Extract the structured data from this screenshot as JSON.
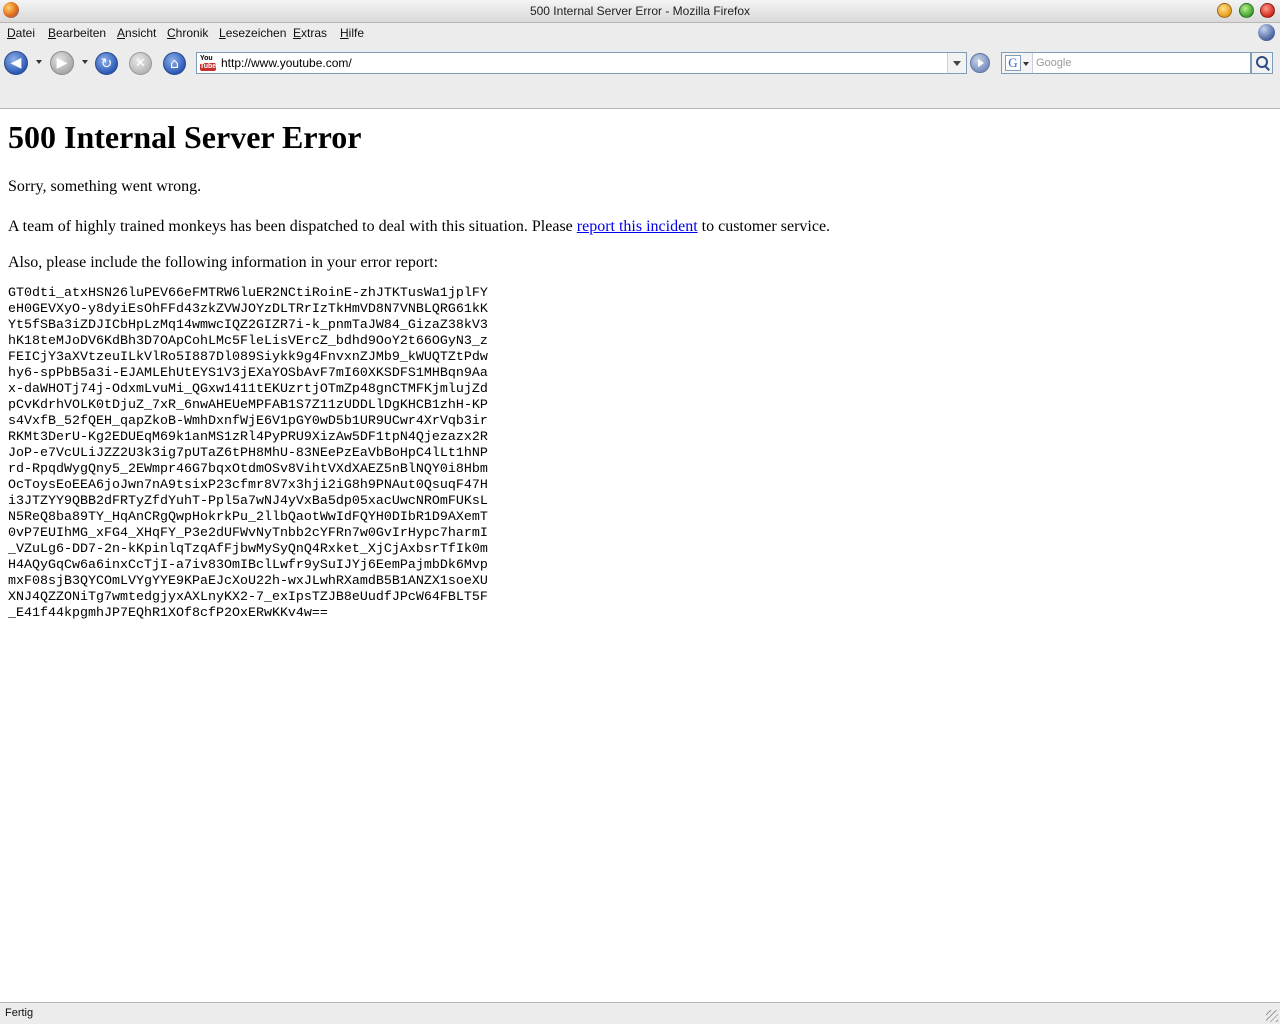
{
  "window": {
    "title": "500 Internal Server Error - Mozilla Firefox"
  },
  "menu": [
    {
      "access": "D",
      "rest": "atei"
    },
    {
      "access": "B",
      "rest": "earbeiten"
    },
    {
      "access": "A",
      "rest": "nsicht"
    },
    {
      "access": "C",
      "rest": "hronik"
    },
    {
      "access": "L",
      "rest": "esezeichen"
    },
    {
      "access": "E",
      "rest": "xtras"
    },
    {
      "access": "H",
      "rest": "ilfe"
    }
  ],
  "navigation": {
    "url": "http://www.youtube.com/",
    "favicon_top": "You",
    "favicon_bottom": "Tube"
  },
  "search": {
    "placeholder": "Google",
    "engine_glyph": "G"
  },
  "page": {
    "heading": "500 Internal Server Error",
    "sorry": "Sorry, something went wrong.",
    "monkeys_before": "A team of highly trained monkeys has been dispatched to deal with this situation. Please ",
    "monkeys_link": "report this incident",
    "monkeys_after": " to customer service.",
    "include": "Also, please include the following information in your error report:",
    "error_code": "GT0dti_atxHSN26luPEV66eFMTRW6luER2NCtiRoinE-zhJTKTusWa1jplFY\neH0GEVXyO-y8dyiEsOhFFd43zkZVWJOYzDLTRrIzTkHmVD8N7VNBLQRG61kK\nYt5fSBa3iZDJICbHpLzMq14wmwcIQZ2GIZR7i-k_pnmTaJW84_GizaZ38kV3\nhK18teMJoDV6KdBh3D7OApCohLMc5FleLisVErcZ_bdhd9OoY2t66OGyN3_z\nFEICjY3aXVtzeuILkVlRo5I887Dl089Siykk9g4FnvxnZJMb9_kWUQTZtPdw\nhy6-spPbB5a3i-EJAMLEhUtEYS1V3jEXaYOSbAvF7mI60XKSDFS1MHBqn9Aa\nx-daWHOTj74j-OdxmLvuMi_QGxw1411tEKUzrtjOTmZp48gnCTMFKjmlujZd\npCvKdrhVOLK0tDjuZ_7xR_6nwAHEUeMPFAB1S7Z11zUDDLlDgKHCB1zhH-KP\ns4VxfB_52fQEH_qapZkoB-WmhDxnfWjE6V1pGY0wD5b1UR9UCwr4XrVqb3ir\nRKMt3DerU-Kg2EDUEqM69k1anMS1zRl4PyPRU9XizAw5DF1tpN4Qjezazx2R\nJoP-e7VcULiJZZ2U3k3ig7pUTaZ6tPH8MhU-83NEePzEaVbBoHpC4lLt1hNP\nrd-RpqdWygQny5_2EWmpr46G7bqxOtdmOSv8VihtVXdXAEZ5nBlNQY0i8Hbm\nOcToysEoEEA6joJwn7nA9tsixP23cfmr8V7x3hji2iG8h9PNAut0QsuqF47H\ni3JTZYY9QBB2dFRTyZfdYuhT-Ppl5a7wNJ4yVxBa5dp05xacUwcNROmFUKsL\nN5ReQ8ba89TY_HqAnCRgQwpHokrkPu_2llbQaotWwIdFQYH0DIbR1D9AXemT\n0vP7EUIhMG_xFG4_XHqFY_P3e2dUFWvNyTnbb2cYFRn7w0GvIrHypc7harmI\n_VZuLg6-DD7-2n-kKpinlqTzqAfFjbwMySyQnQ4Rxket_XjCjAxbsrTfIk0m\nH4AQyGqCw6a6inxCcTjI-a7iv83OmIBclLwfr9ySuIJYj6EemPajmbDk6Mvp\nmxF08sjB3QYCOmLVYgYYE9KPaEJcXoU22h-wxJLwhRXamdB5B1ANZX1soeXU\nXNJ4QZZONiTg7wmtedgjyxAXLnyKX2-7_exIpsTZJB8eUudfJPcW64FBLT5F\n_E41f44kpgmhJP7EQhR1XOf8cfP2OxERwKKv4w=="
  },
  "status": {
    "text": "Fertig"
  }
}
